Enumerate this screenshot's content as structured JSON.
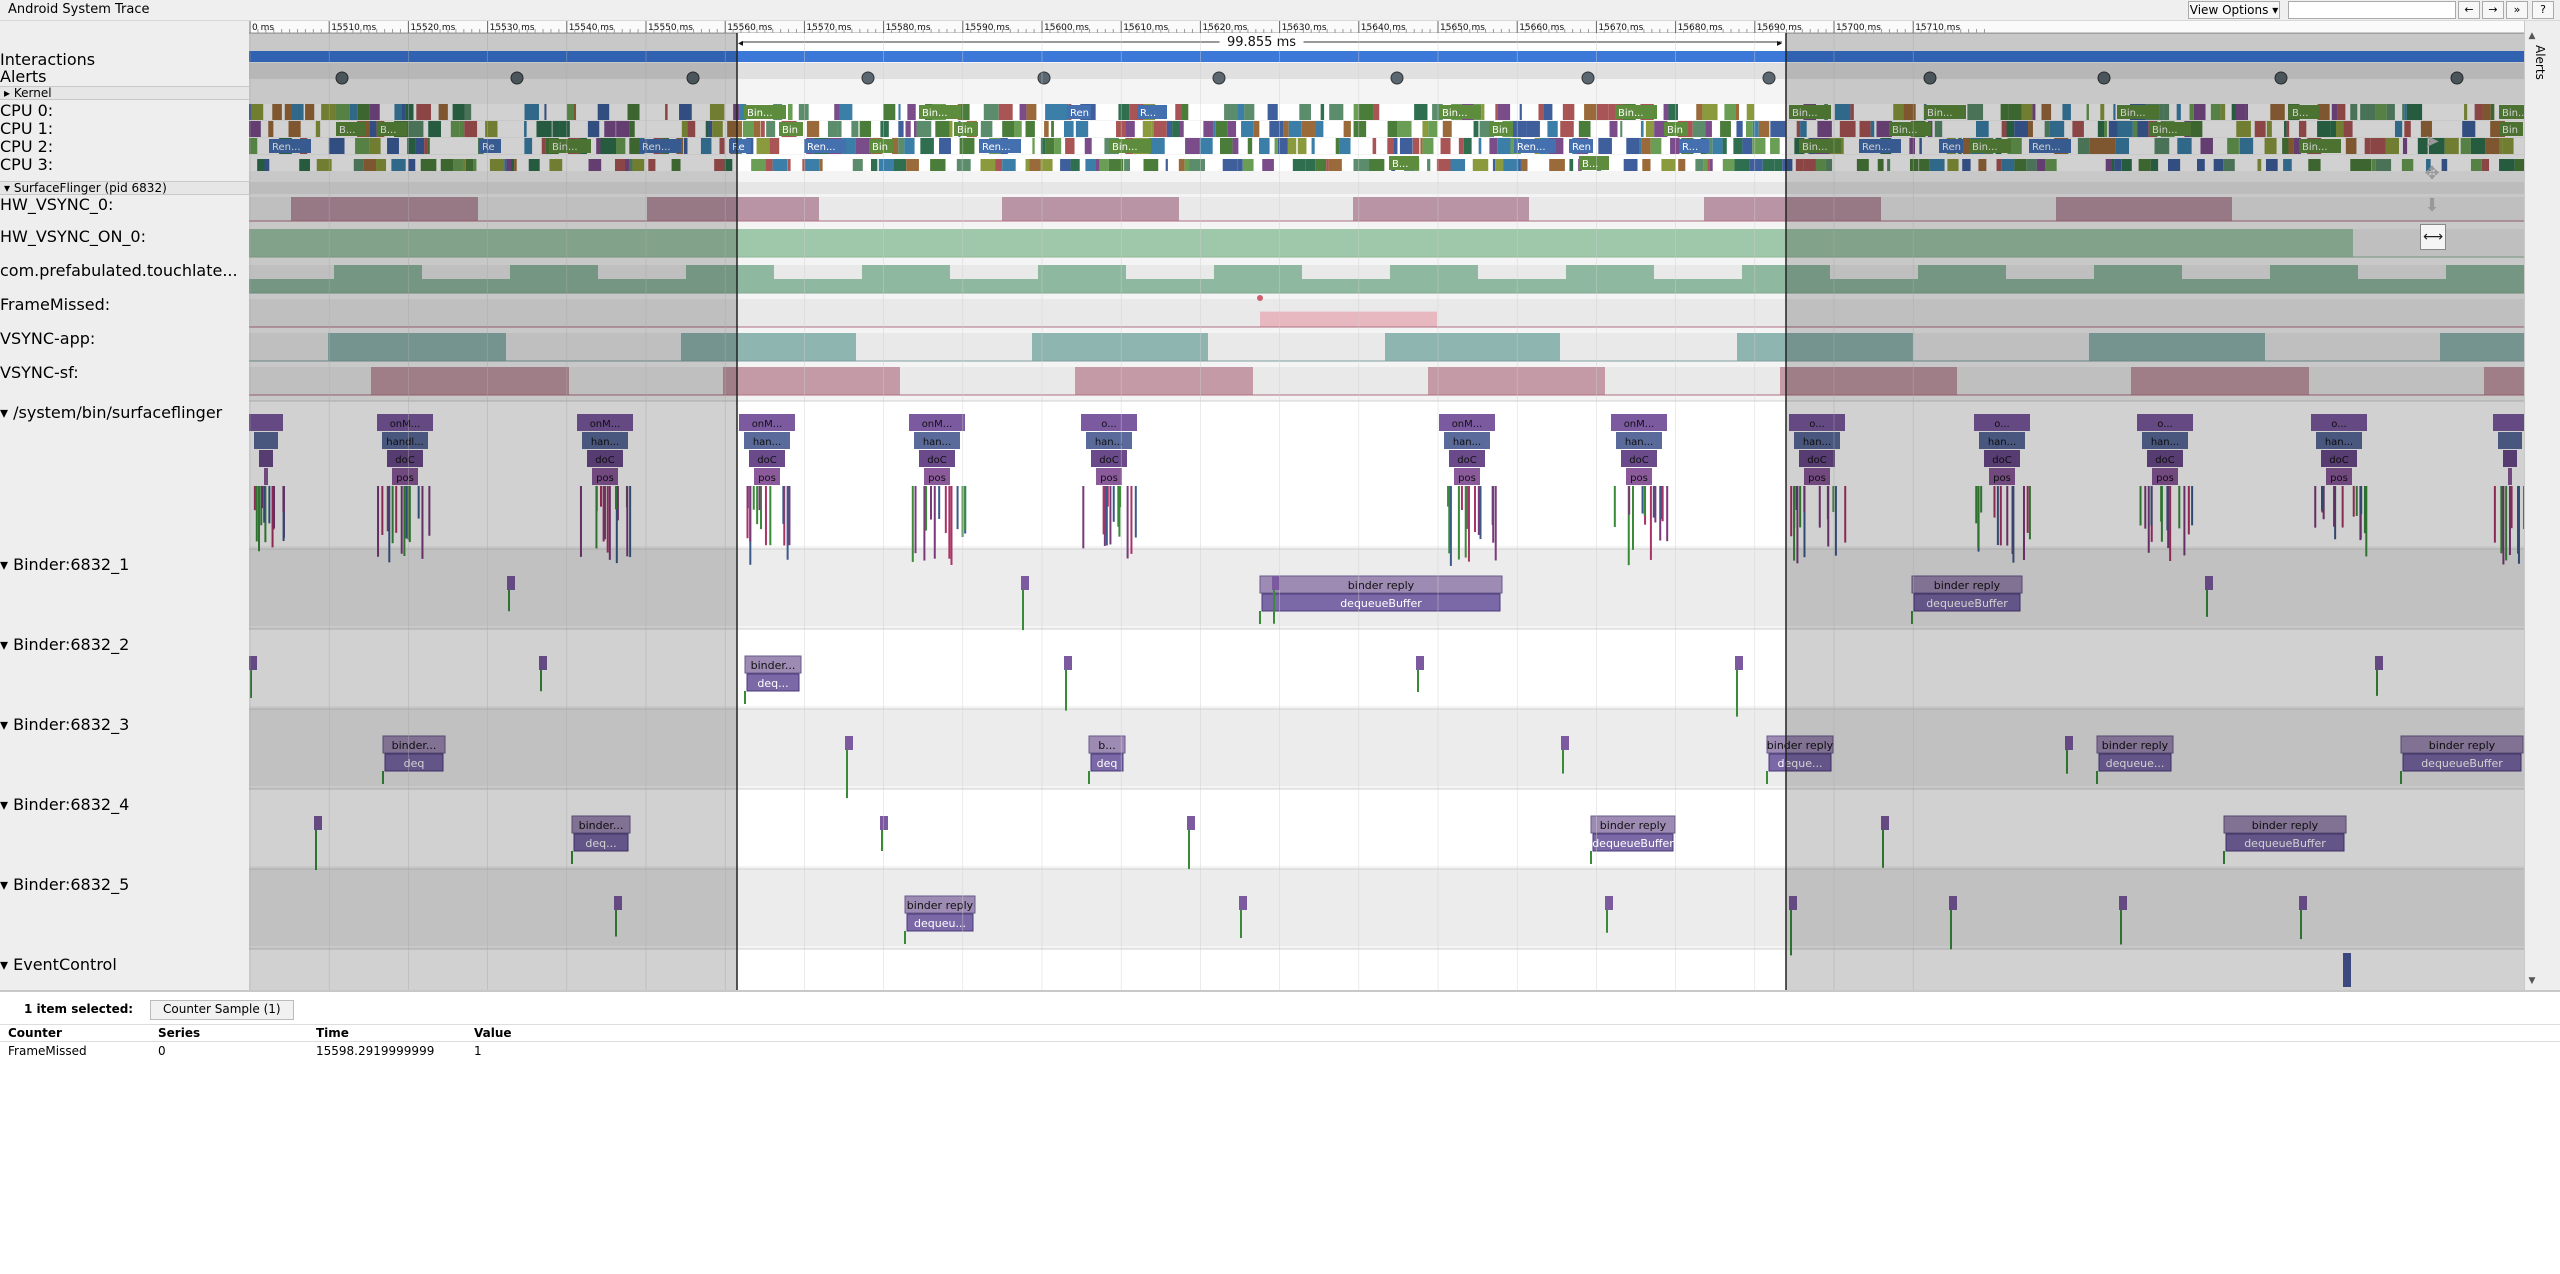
{
  "window": {
    "title": "Android System Trace"
  },
  "toolbar": {
    "view_options": "View Options ▾",
    "search_placeholder": "",
    "nav_buttons": [
      "←",
      "→",
      "»",
      "?"
    ]
  },
  "ruler": {
    "unit": "ms",
    "ticks": [
      "0 ms",
      "15510 ms",
      "15520 ms",
      "15530 ms",
      "15540 ms",
      "15550 ms",
      "15560 ms",
      "15570 ms",
      "15580 ms",
      "15590 ms",
      "15600 ms",
      "15610 ms",
      "15620 ms",
      "15630 ms",
      "15640 ms",
      "15650 ms",
      "15660 ms",
      "15670 ms",
      "15680 ms",
      "15690 ms",
      "15700 ms",
      "15710 ms"
    ],
    "selection_duration": "99.855 ms"
  },
  "tracks": {
    "interactions": "Interactions",
    "alerts": "Alerts",
    "kernel_header": "▸ Kernel",
    "cpus": [
      "CPU 0:",
      "CPU 1:",
      "CPU 2:",
      "CPU 3:"
    ],
    "process_header": "▾ SurfaceFlinger (pid 6832)",
    "counters": [
      "HW_VSYNC_0:",
      "HW_VSYNC_ON_0:",
      "com.prefabulated.touchlate...",
      "FrameMissed:",
      "VSYNC-app:",
      "VSYNC-sf:"
    ],
    "threads": [
      "▾  /system/bin/surfaceflinger",
      "▾  Binder:6832_1",
      "▾  Binder:6832_2",
      "▾  Binder:6832_3",
      "▾  Binder:6832_4",
      "▾  Binder:6832_5",
      "▾  EventControl"
    ]
  },
  "slices": {
    "cpu_labels": [
      "Bin...",
      "B...",
      "Ren...",
      "Re",
      "R...",
      "Bin"
    ],
    "sf_labels": [
      "onM...",
      "handl...",
      "doC",
      "pos",
      "han...",
      "o...",
      "h..."
    ],
    "binder_reply": "binder reply",
    "binder_short": "binder...",
    "dequeue": "dequeueBuffer",
    "deq_short": "deq...",
    "dequeu_short": "dequeu...",
    "deq2": "deq",
    "b_short": "b..."
  },
  "colors": {
    "selection_bar": "#3c78d8",
    "vsync0": "#b994a4",
    "vsync_on": "#9fc7a9",
    "touchlate": "#8fb8a0",
    "framemissed": "#e8b8c0",
    "vsync_app": "#8fb5b0",
    "vsync_sf": "#c49aa6",
    "binder_slice": "#9e8bb4",
    "dequeue_slice": "#7b68a6"
  },
  "right_strip": {
    "alerts_tab": "Alerts"
  },
  "bottom": {
    "selection_label": "1 item selected:",
    "tab": "Counter Sample (1)",
    "columns": [
      "Counter",
      "Series",
      "Time",
      "Value"
    ],
    "row": [
      "FrameMissed",
      "0",
      "15598.2919999999",
      "1"
    ]
  }
}
